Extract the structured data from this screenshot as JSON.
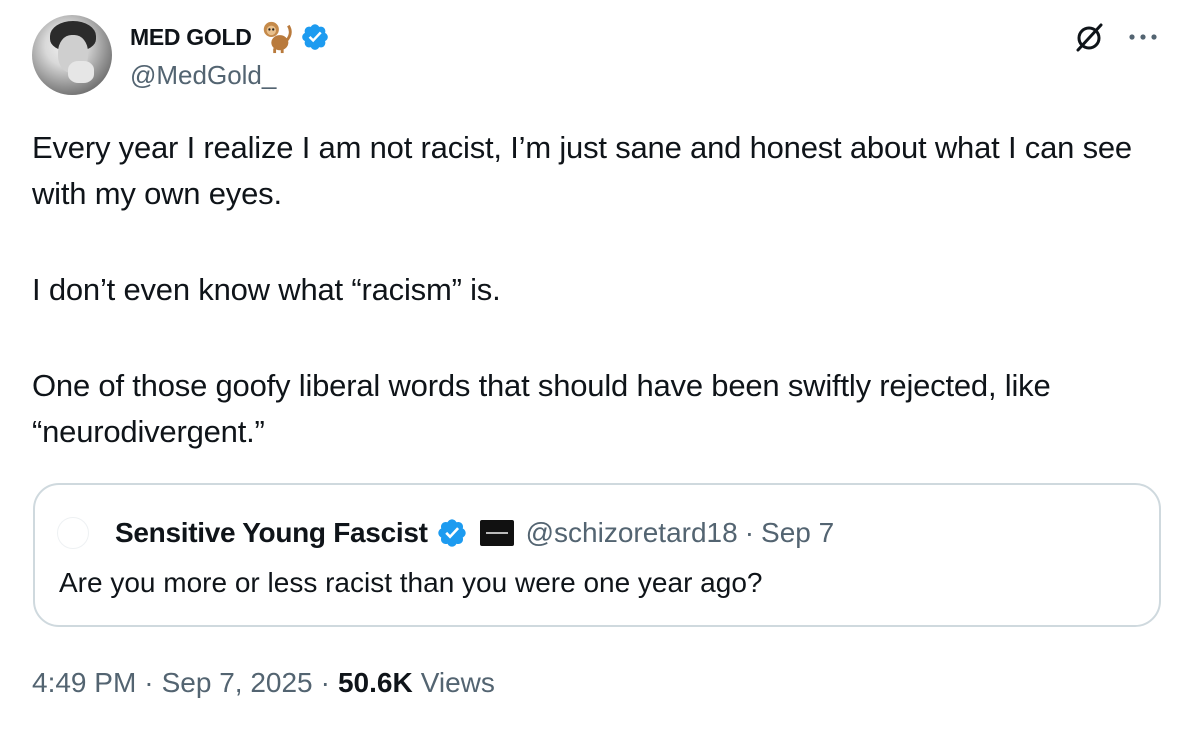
{
  "author": {
    "display_name": "MED GOLD",
    "emoji": "monkey-emoji",
    "handle": "@MedGold_",
    "verified": true
  },
  "tweet": {
    "paragraphs": [
      "Every year I realize I am not racist, I’m just sane and honest about what I can see with my own eyes.",
      "I don’t even know what “racism” is.",
      "One of those goofy liberal words that should have been swiftly rejected, like “neurodivergent.”"
    ]
  },
  "quote": {
    "display_name": "Sensitive Young Fascist",
    "handle": "@schizoretard18",
    "separator": "·",
    "date": "Sep 7",
    "text": "Are you more or less racist than you were one year ago?"
  },
  "meta": {
    "time": "4:49 PM",
    "date": "Sep 7, 2025",
    "separator": "·",
    "views_count": "50.6K",
    "views_label": "Views"
  },
  "colors": {
    "verified": "#1d9bf0",
    "secondary_text": "#536471",
    "border": "#cfd9de"
  },
  "icons": [
    "monkey-emoji",
    "verified-badge-icon",
    "grok-icon",
    "more-options-icon"
  ]
}
